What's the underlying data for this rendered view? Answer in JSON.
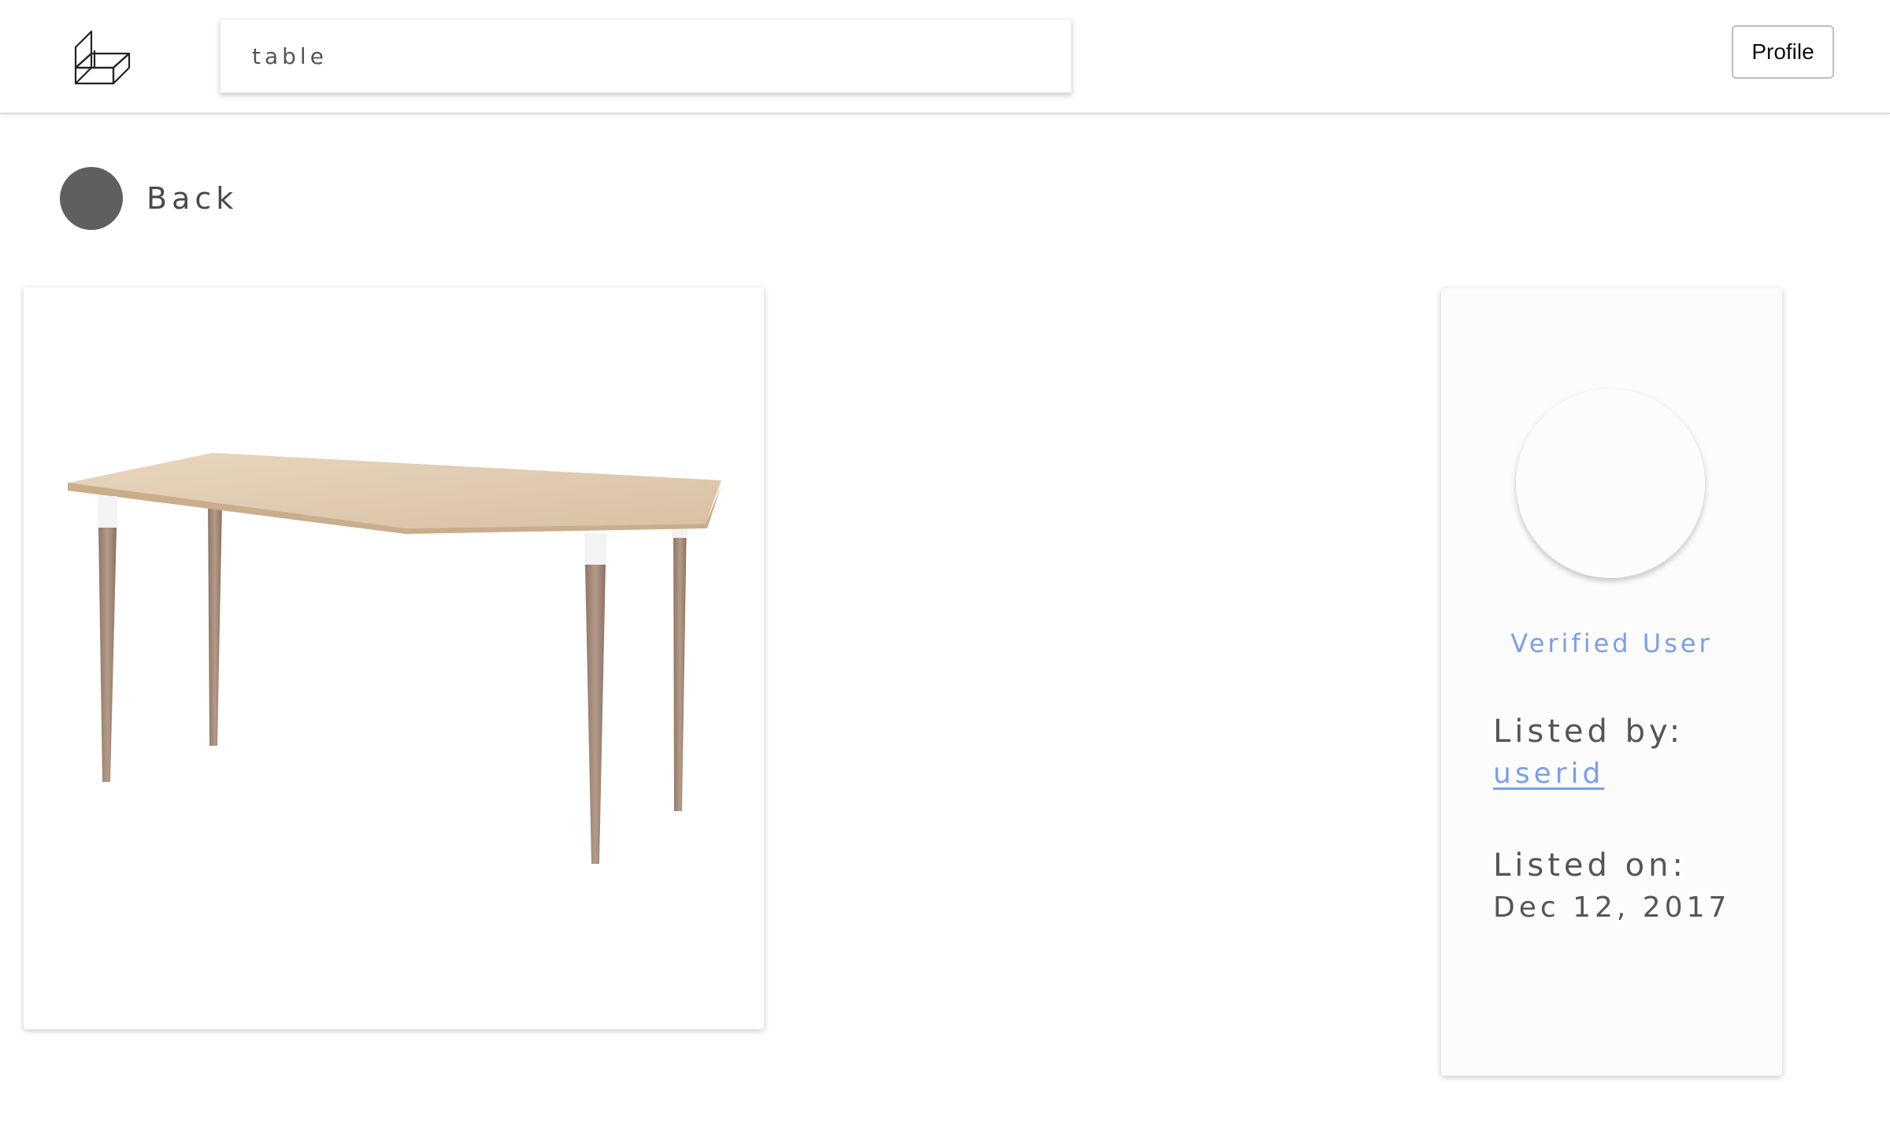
{
  "header": {
    "logo_icon": "cube-box-logo-icon",
    "search": {
      "value": "table",
      "placeholder": ""
    },
    "profile_label": "Profile"
  },
  "nav": {
    "back_icon": "circle-back-icon",
    "back_label": "Back"
  },
  "listing": {
    "image_alt": "wooden desk with tapered legs",
    "image_icon": "table-product-image"
  },
  "seller": {
    "avatar_icon": "user-avatar",
    "verified_label": "Verified User",
    "listed_by_label": "Listed by:",
    "listed_by_value": "userid",
    "listed_on_label": "Listed on:",
    "listed_on_value": "Dec 12, 2017"
  },
  "colors": {
    "accent": "#7b9eeb",
    "text": "#555555",
    "back_circle": "#5f5f5f"
  }
}
